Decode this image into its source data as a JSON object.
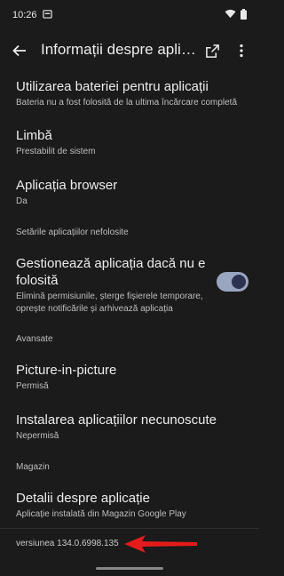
{
  "status": {
    "time": "10:26"
  },
  "appbar": {
    "title": "Informații despre aplicație"
  },
  "items": [
    {
      "title": "Utilizarea bateriei pentru aplicații",
      "subtitle": "Bateria nu a fost folosită de la ultima încărcare completă"
    },
    {
      "title": "Limbă",
      "subtitle": "Prestabilit de sistem"
    },
    {
      "title": "Aplicația browser",
      "subtitle": "Da"
    }
  ],
  "unused": {
    "header": "Setările aplicațiilor nefolosite",
    "title": "Gestionează aplicația dacă nu e folosită",
    "subtitle": "Elimină permisiunile, șterge fișierele temporare, oprește notificările și arhivează aplicația",
    "toggle_on": true
  },
  "advanced": {
    "header": "Avansate",
    "items": [
      {
        "title": "Picture-in-picture",
        "subtitle": "Permisă"
      },
      {
        "title": "Instalarea aplicațiilor necunoscute",
        "subtitle": "Nepermisă"
      }
    ]
  },
  "store": {
    "header": "Magazin",
    "title": "Detalii despre aplicație",
    "subtitle": "Aplicație instalată din Magazin Google Play"
  },
  "version": "versiunea 134.0.6998.135",
  "colors": {
    "background": "#1b1b1b",
    "annotation_arrow": "#e31b1b",
    "toggle_track": "#9aa5c0"
  }
}
